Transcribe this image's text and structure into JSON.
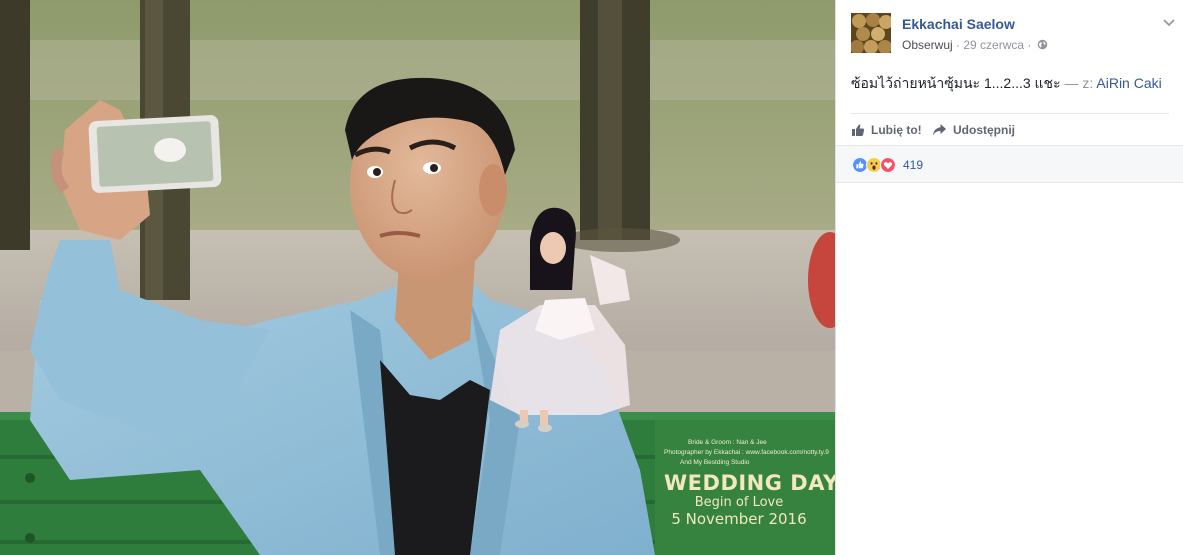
{
  "post": {
    "author": "Ekkachai Saelow",
    "follow_label": "Obserwuj",
    "separator": "·",
    "date": "29 czerwca",
    "caption_text": "ซ้อมไว้ถ่ายหน้าซุ้มนะ 1...2...3 แชะ",
    "with_label": "— z:",
    "tagged_user": "AiRin Caki"
  },
  "actions": {
    "like_label": "Lubię to!",
    "share_label": "Udostępnij"
  },
  "reactions": {
    "types": [
      "like",
      "wow",
      "love"
    ],
    "count": "419"
  },
  "photo": {
    "credit_1": "Bride & Groom : Nan & Jee",
    "credit_2": "Photographer by Ekkachai : www.facebook.com/notty.ty.9",
    "credit_3": "And My Bestding Studio",
    "title": "WEDDING DAY",
    "subtitle": "Begin of Love",
    "date": "5 November 2016"
  },
  "colors": {
    "link_blue": "#365899",
    "like_blue": "#5890ff",
    "love_red": "#f25268",
    "wow_yellow": "#f7cb4d",
    "bench_green": "#2d7a3b",
    "jacket_blue": "#8fbcd6"
  }
}
